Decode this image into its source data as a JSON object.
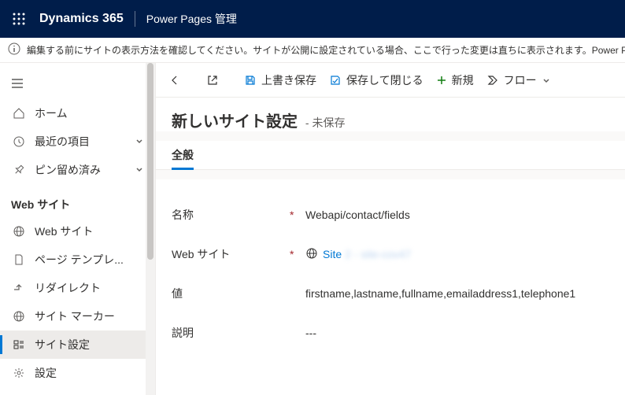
{
  "topbar": {
    "brand": "Dynamics 365",
    "app": "Power Pages 管理"
  },
  "infobar": {
    "text": "編集する前にサイトの表示方法を確認してください。サイトが公開に設定されている場合、ここで行った変更は直ちに表示されます。Power P"
  },
  "nav": {
    "home": "ホーム",
    "recent": "最近の項目",
    "pinned": "ピン留め済み",
    "group": "Web サイト",
    "items": {
      "websites": "Web サイト",
      "pagetemplates": "ページ テンプレ...",
      "redirects": "リダイレクト",
      "sitemarkers": "サイト マーカー",
      "sitesettings": "サイト設定",
      "settings": "設定"
    }
  },
  "cmd": {
    "save": "上書き保存",
    "saveclose": "保存して閉じる",
    "new": "新規",
    "flow": "フロー"
  },
  "header": {
    "title": "新しいサイト設定",
    "subtitle": "- 未保存"
  },
  "tabs": {
    "general": "全般"
  },
  "form": {
    "name_label": "名称",
    "name_value": "Webapi/contact/fields",
    "site_label": "Web サイト",
    "site_value": "Site",
    "site_blur": "2 - site-cov47",
    "value_label": "値",
    "value_value": "firstname,lastname,fullname,emailaddress1,telephone1",
    "desc_label": "説明",
    "desc_value": "---"
  }
}
